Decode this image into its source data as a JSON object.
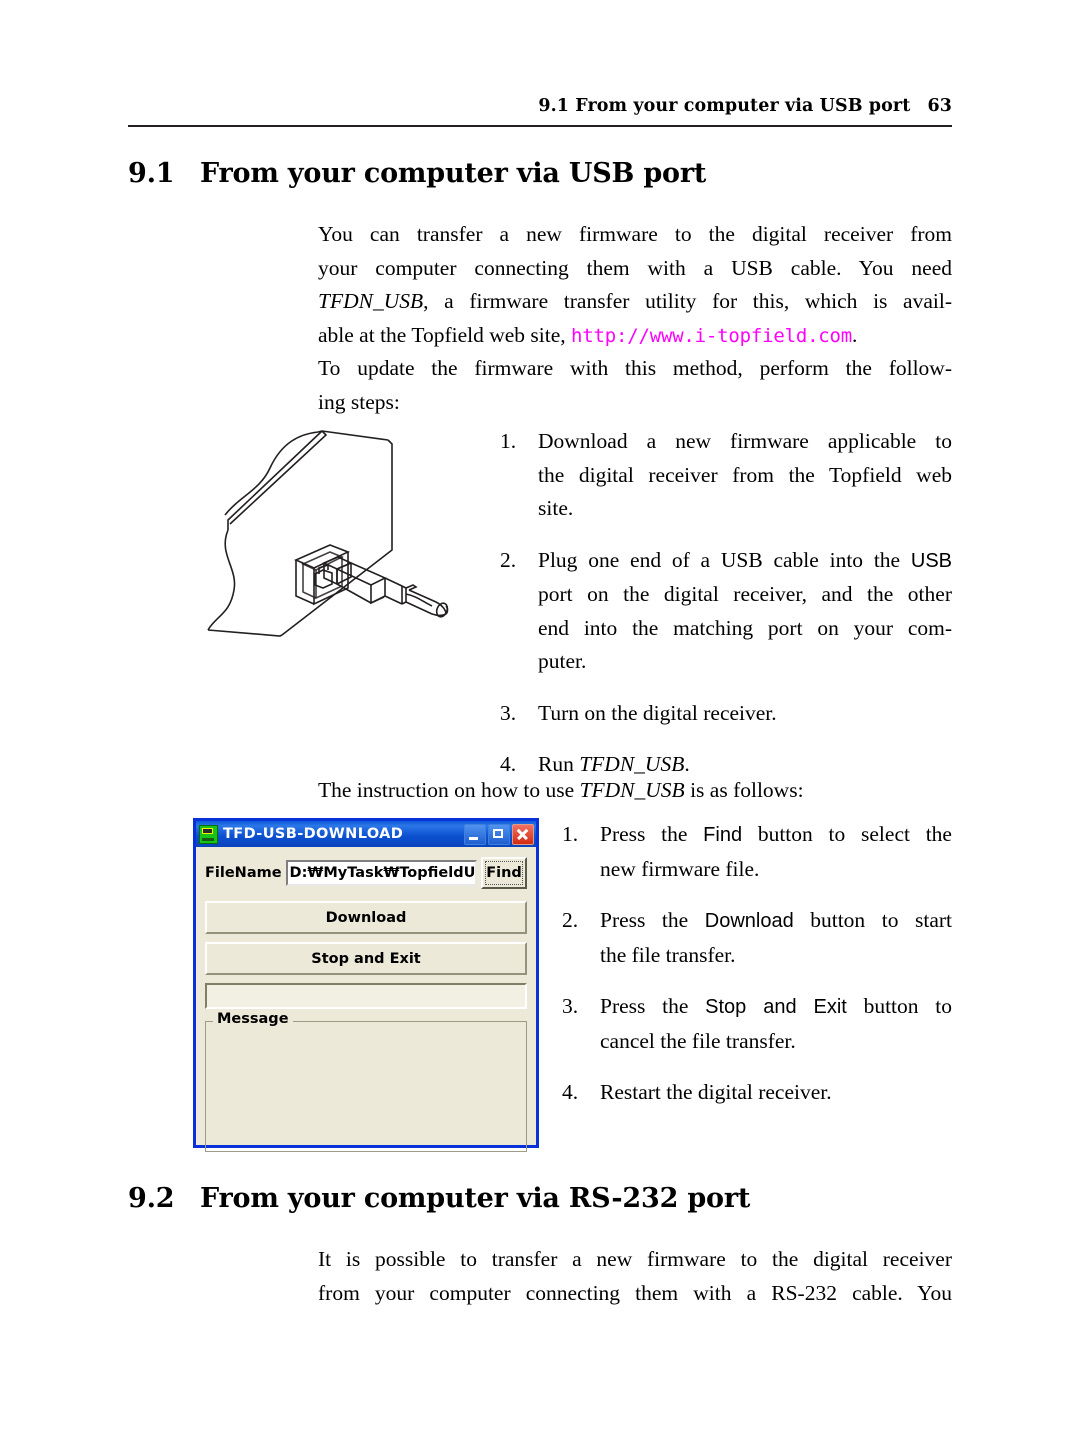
{
  "running_head": {
    "title": "9.1 From your computer via USB port",
    "page_number": "63"
  },
  "sections": {
    "usb": {
      "number": "9.1",
      "title": "From your computer via USB port",
      "intro_line1": "You can transfer a new firmware to the digital receiver from",
      "intro_line2": "your computer connecting them with a USB cable. You need",
      "intro_line3_prog": "TFDN_USB",
      "intro_line3_rest": ", a firmware transfer utility for this, which is avail-",
      "intro_line4_pre": "able at the Topfield web site, ",
      "intro_line4_url": "http://www.i-topfield.com",
      "intro_line4_post": ".",
      "update_line1": "To update the firmware with this method, perform the follow-",
      "update_line2": "ing steps:",
      "steps": [
        {
          "marker": "1.",
          "line1": "Download a new firmware applicable to",
          "line2": "the digital receiver from the Topfield web",
          "line3": "site."
        },
        {
          "marker": "2.",
          "line1_pre": "Plug one end of a USB cable into the ",
          "line1_ui": "USB",
          "line2": "port on the digital receiver, and the other",
          "line3": "end into the matching port on your com-",
          "line4": "puter."
        },
        {
          "marker": "3.",
          "line1": "Turn on the digital receiver."
        },
        {
          "marker": "4.",
          "line1_pre": "Run ",
          "line1_prog": "TFDN_USB",
          "line1_post": "."
        }
      ],
      "instruction_lead_pre": "The instruction on how to use ",
      "instruction_lead_prog": "TFDN_USB",
      "instruction_lead_post": " is as follows:",
      "tfdn_steps": [
        {
          "marker": "1.",
          "pre": "Press the ",
          "ui": "Find",
          "post": " button to select the",
          "line2": "new firmware file."
        },
        {
          "marker": "2.",
          "pre": "Press the ",
          "ui": "Download",
          "post": " button to start",
          "line2": "the file transfer."
        },
        {
          "marker": "3.",
          "pre": "Press the ",
          "ui": "Stop and Exit",
          "post": " button to",
          "line2": "cancel the file transfer."
        },
        {
          "marker": "4.",
          "pre": "Restart the digital receiver.",
          "ui": "",
          "post": "",
          "line2": ""
        }
      ]
    },
    "rs232": {
      "number": "9.2",
      "title": "From your computer via RS-232 port",
      "line1": "It is possible to transfer a new firmware to the digital receiver",
      "line2": "from your computer connecting them with a RS-232 cable. You"
    }
  },
  "dialog": {
    "title": "TFD-USB-DOWNLOAD",
    "icon": "set-top-box-icon",
    "window_buttons": {
      "minimize": "minimize-icon",
      "maximize": "maximize-icon",
      "close": "close-icon"
    },
    "filename_label": "FileName",
    "filename_value": "D:₩MyTask₩TopfieldUpdate₩(TF",
    "find_button": "Find",
    "download_button": "Download",
    "stop_exit_button": "Stop and Exit",
    "progress_value": "",
    "message_group_label": "Message",
    "message_text": "",
    "colors": {
      "titlebar": "#0b4fcf",
      "face": "#ece9d8",
      "border": "#0831d9",
      "close_button": "#d42a12"
    }
  },
  "figure": {
    "name": "usb-b-port-and-plug-illustration"
  },
  "colors": {
    "url": "#ff00ff",
    "text": "#000000",
    "rule": "#231f20"
  }
}
